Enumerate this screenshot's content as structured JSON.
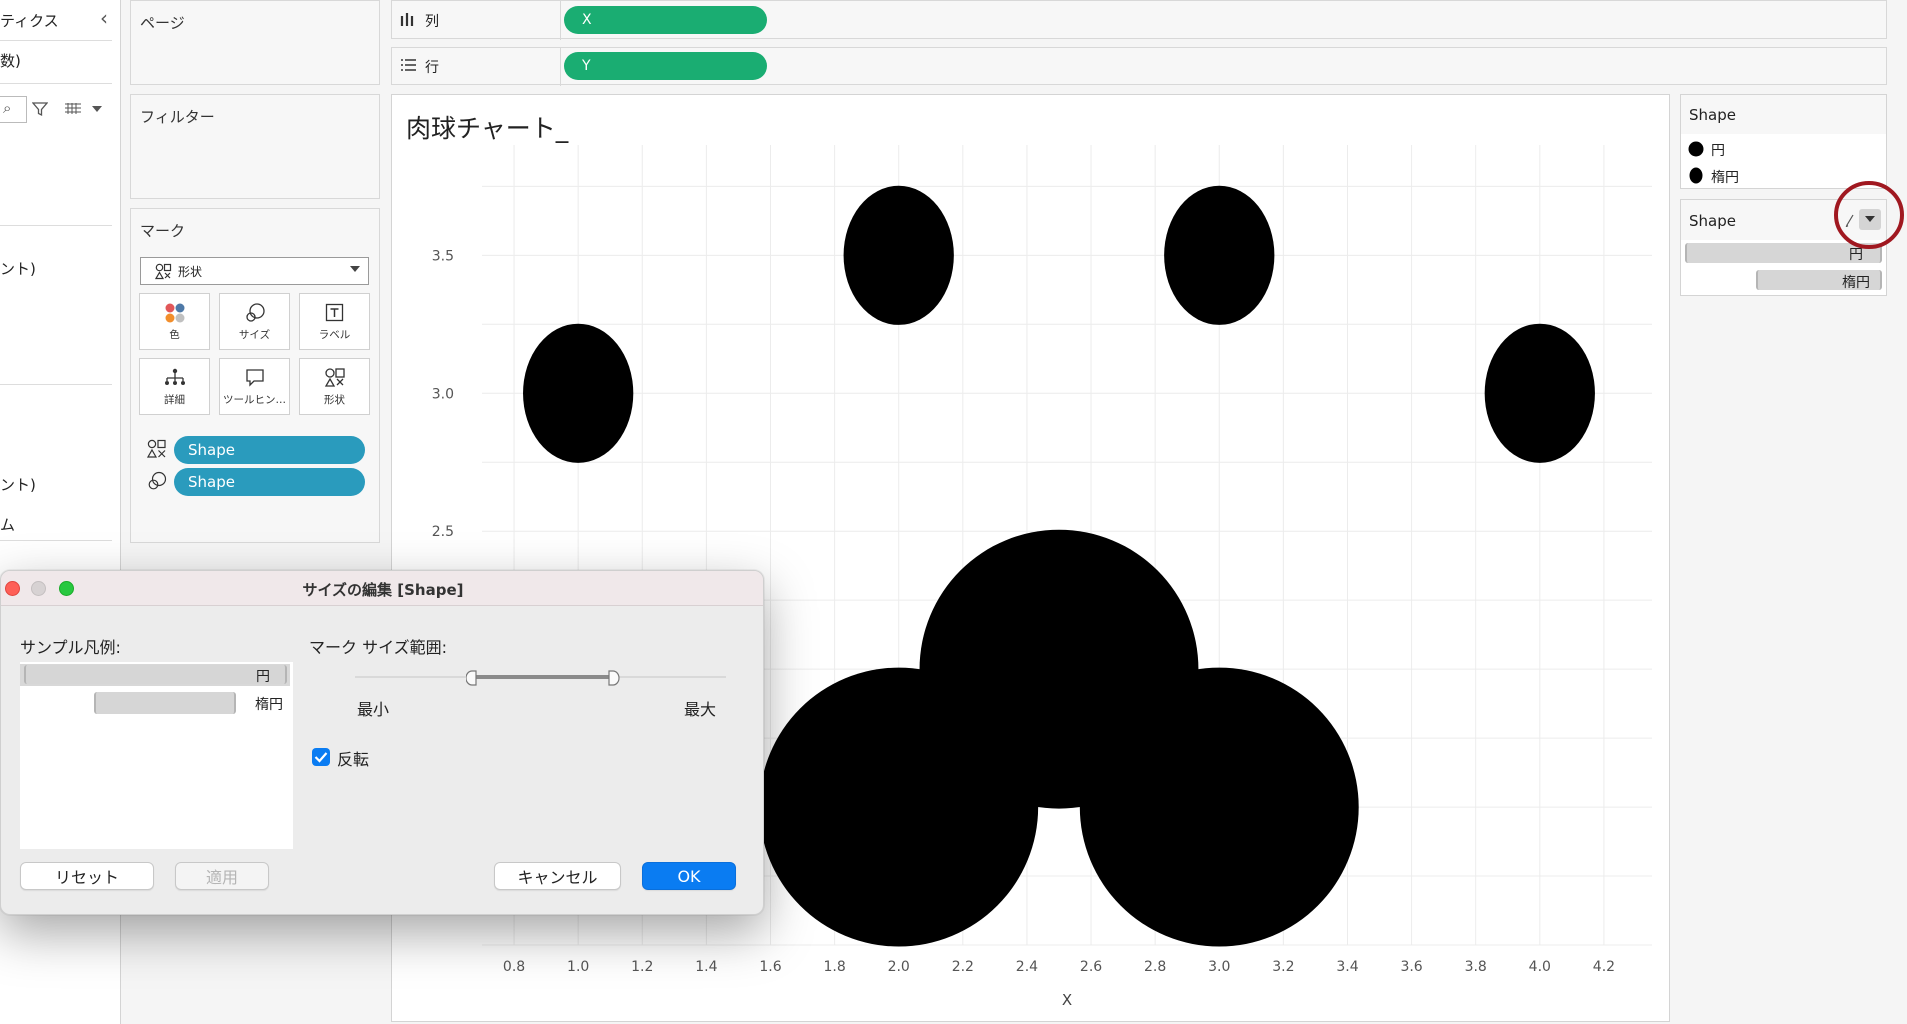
{
  "data_pane": {
    "title": "ティクス",
    "row1": "数)",
    "row2": "ント)",
    "row3": "ント)",
    "row4": "ム"
  },
  "shelves": {
    "pages_title": "ページ",
    "filters_title": "フィルター",
    "marks_title": "マーク",
    "mark_type": "形状",
    "columns_label": "列",
    "rows_label": "行",
    "columns_pill": "X",
    "rows_pill": "Y",
    "mark_buttons": {
      "color": "色",
      "size": "サイズ",
      "label": "ラベル",
      "detail": "詳細",
      "tooltip": "ツールヒン…",
      "shape": "形状"
    },
    "mark_pills": [
      {
        "icon": "shape-icon",
        "label": "Shape"
      },
      {
        "icon": "size-icon",
        "label": "Shape"
      }
    ]
  },
  "chart_data": {
    "type": "scatter",
    "title": "肉球チャート_",
    "xlabel": "X",
    "ylabel": "Y",
    "xlim": [
      0.7,
      4.35
    ],
    "ylim": [
      1.0,
      3.9
    ],
    "xticks": [
      "0.8",
      "1.0",
      "1.2",
      "1.4",
      "1.6",
      "1.8",
      "2.0",
      "2.2",
      "2.4",
      "2.6",
      "2.8",
      "3.0",
      "3.2",
      "3.4",
      "3.6",
      "3.8",
      "4.0",
      "4.2"
    ],
    "yticks": [
      "2.5",
      "3.0",
      "3.5"
    ],
    "grid": true,
    "series": [
      {
        "name": "楕円",
        "shape": "ellipse",
        "points": [
          [
            1.0,
            3.0
          ],
          [
            2.0,
            3.5
          ],
          [
            3.0,
            3.5
          ],
          [
            4.0,
            3.0
          ]
        ]
      },
      {
        "name": "円",
        "shape": "circle",
        "points": [
          [
            2.5,
            2.0
          ],
          [
            2.0,
            1.5
          ],
          [
            3.0,
            1.5
          ]
        ]
      }
    ],
    "color": "#000000"
  },
  "legend_shape": {
    "title": "Shape",
    "items": [
      "円",
      "楕円"
    ]
  },
  "legend_size": {
    "title": "Shape",
    "items": [
      "円",
      "楕円"
    ]
  },
  "dialog": {
    "title": "サイズの編集 [Shape]",
    "sample_legend_label": "サンプル凡例:",
    "samples": [
      "円",
      "楕円"
    ],
    "range_label": "マーク サイズ範囲:",
    "min_label": "最小",
    "max_label": "最大",
    "reverse_label": "反転",
    "reverse_checked": true,
    "reset_label": "リセット",
    "apply_label": "適用",
    "cancel_label": "キャンセル",
    "ok_label": "OK",
    "accent": "#0a7cf2"
  }
}
